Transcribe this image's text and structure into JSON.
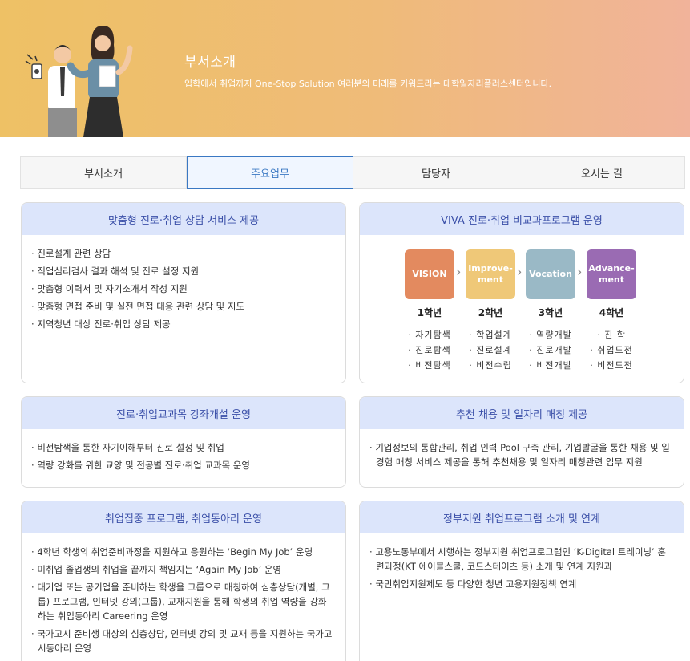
{
  "hero": {
    "title": "부서소개",
    "subtitle": "입학에서 취업까지 One-Stop Solution 여러분의 미래를 키워드리는 대학일자리플러스센터입니다."
  },
  "tabs": [
    {
      "label": "부서소개",
      "active": false
    },
    {
      "label": "주요업무",
      "active": true
    },
    {
      "label": "담당자",
      "active": false
    },
    {
      "label": "오시는 길",
      "active": false
    }
  ],
  "cards": {
    "c1": {
      "title": "맞춤형 진로·취업 상담 서비스 제공",
      "items": [
        "진로설계 관련 상담",
        "직업심리검사 결과 해석 및 진로 설정 지원",
        "맞춤형 이력서 및 자기소개서 작성 지원",
        "맞춤형 면접 준비 및 실전 면접 대응 관련 상담 및 지도",
        "지역청년 대상 진로·취업 상담 제공"
      ]
    },
    "c2": {
      "title": "VIVA 진로·취업 비교과프로그램 운영",
      "steps": [
        {
          "label": "VISION",
          "year": "1학년",
          "items": [
            "자기탐색",
            "진로탐색",
            "비전탐색"
          ],
          "color": "#e38a5f"
        },
        {
          "label": "Improve-ment",
          "year": "2학년",
          "items": [
            "학업설계",
            "진로설계",
            "비전수립"
          ],
          "color": "#efc878"
        },
        {
          "label": "Vocation",
          "year": "3학년",
          "items": [
            "역량개발",
            "진로개발",
            "비전개발"
          ],
          "color": "#9ab9c6"
        },
        {
          "label": "Advance-ment",
          "year": "4학년",
          "items": [
            "진   학",
            "취업도전",
            "비전도전"
          ],
          "color": "#9a6bb3"
        }
      ]
    },
    "c3": {
      "title": "진로·취업교과목 강좌개설 운영",
      "items": [
        "비전탐색을 통한 자기이해부터 진로 설정 및 취업",
        "역량 강화를 위한 교양 및 전공별 진로·취업 교과목 운영"
      ]
    },
    "c4": {
      "title": "추천 채용 및 일자리 매칭 제공",
      "items": [
        "기업정보의 통합관리, 취업 인력 Pool 구축 관리, 기업발굴을 통한 채용 및 일경험 매칭 서비스 제공을 통해 추천채용 및 일자리 매칭관련 업무 지원"
      ]
    },
    "c5": {
      "title": "취업집중 프로그램, 취업동아리 운영",
      "items": [
        "4학년 학생의 취업준비과정을 지원하고 응원하는 ‘Begin My Job’ 운영",
        "미취업 졸업생의 취업을 끝까지 책임지는 ‘Again My Job’ 운영",
        "대기업 또는 공기업을 준비하는 학생을 그룹으로 매칭하여 심층상담(개별, 그룹) 프로그램, 인터넷 강의(그룹), 교재지원을 통해 학생의 취업 역량을 강화하는 취업동아리 Careering 운영",
        "국가고시 준비생 대상의 심층상담, 인터넷 강의 및 교재 등을 지원하는 국가고시동아리 운영"
      ]
    },
    "c6": {
      "title": "정부지원 취업프로그램 소개 및 연계",
      "items": [
        "고용노동부에서 시행하는 정부지원 취업프로그램인 ‘K-Digital 트레이닝’ 훈련과정(KT 에이블스쿨, 코드스테이츠 등) 소개 및 연계 지원과",
        "국민취업지원제도 등 다양한 청년 고용지원정책 연계"
      ]
    }
  }
}
